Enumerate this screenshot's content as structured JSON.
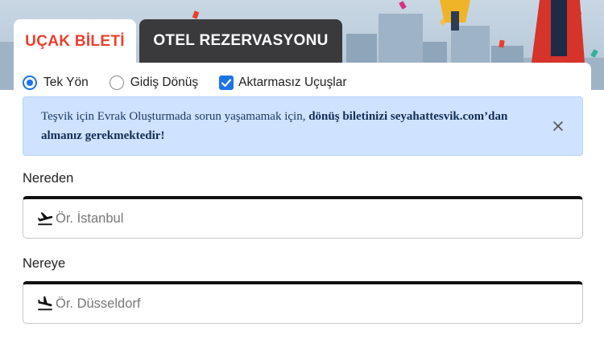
{
  "tabs": [
    {
      "label": "UÇAK BİLETİ",
      "active": true
    },
    {
      "label": "OTEL REZERVASYONU",
      "active": false
    }
  ],
  "trip_options": [
    {
      "label": "Tek Yön",
      "type": "radio",
      "selected": true
    },
    {
      "label": "Gidiş Dönüş",
      "type": "radio",
      "selected": false
    },
    {
      "label": "Aktarmasız Uçuşlar",
      "type": "checkbox",
      "checked": true
    }
  ],
  "alert": {
    "text_plain": "Teşvik için Evrak Oluşturmada sorun yaşamamak için, ",
    "text_bold": "dönüş biletinizi seyahattesvik.com’dan almanız gerekmektedir!",
    "close_icon": "close-icon"
  },
  "from": {
    "label": "Nereden",
    "placeholder": "Ör. İstanbul",
    "value": "",
    "icon": "plane-takeoff-icon"
  },
  "to": {
    "label": "Nereye",
    "placeholder": "Ör. Düsseldorf",
    "value": "",
    "icon": "plane-landing-icon"
  },
  "colors": {
    "accent": "#e8402e",
    "primary": "#1a73e8",
    "tab_dark": "#3a3a3c",
    "alert_bg": "#cfe2ff"
  }
}
